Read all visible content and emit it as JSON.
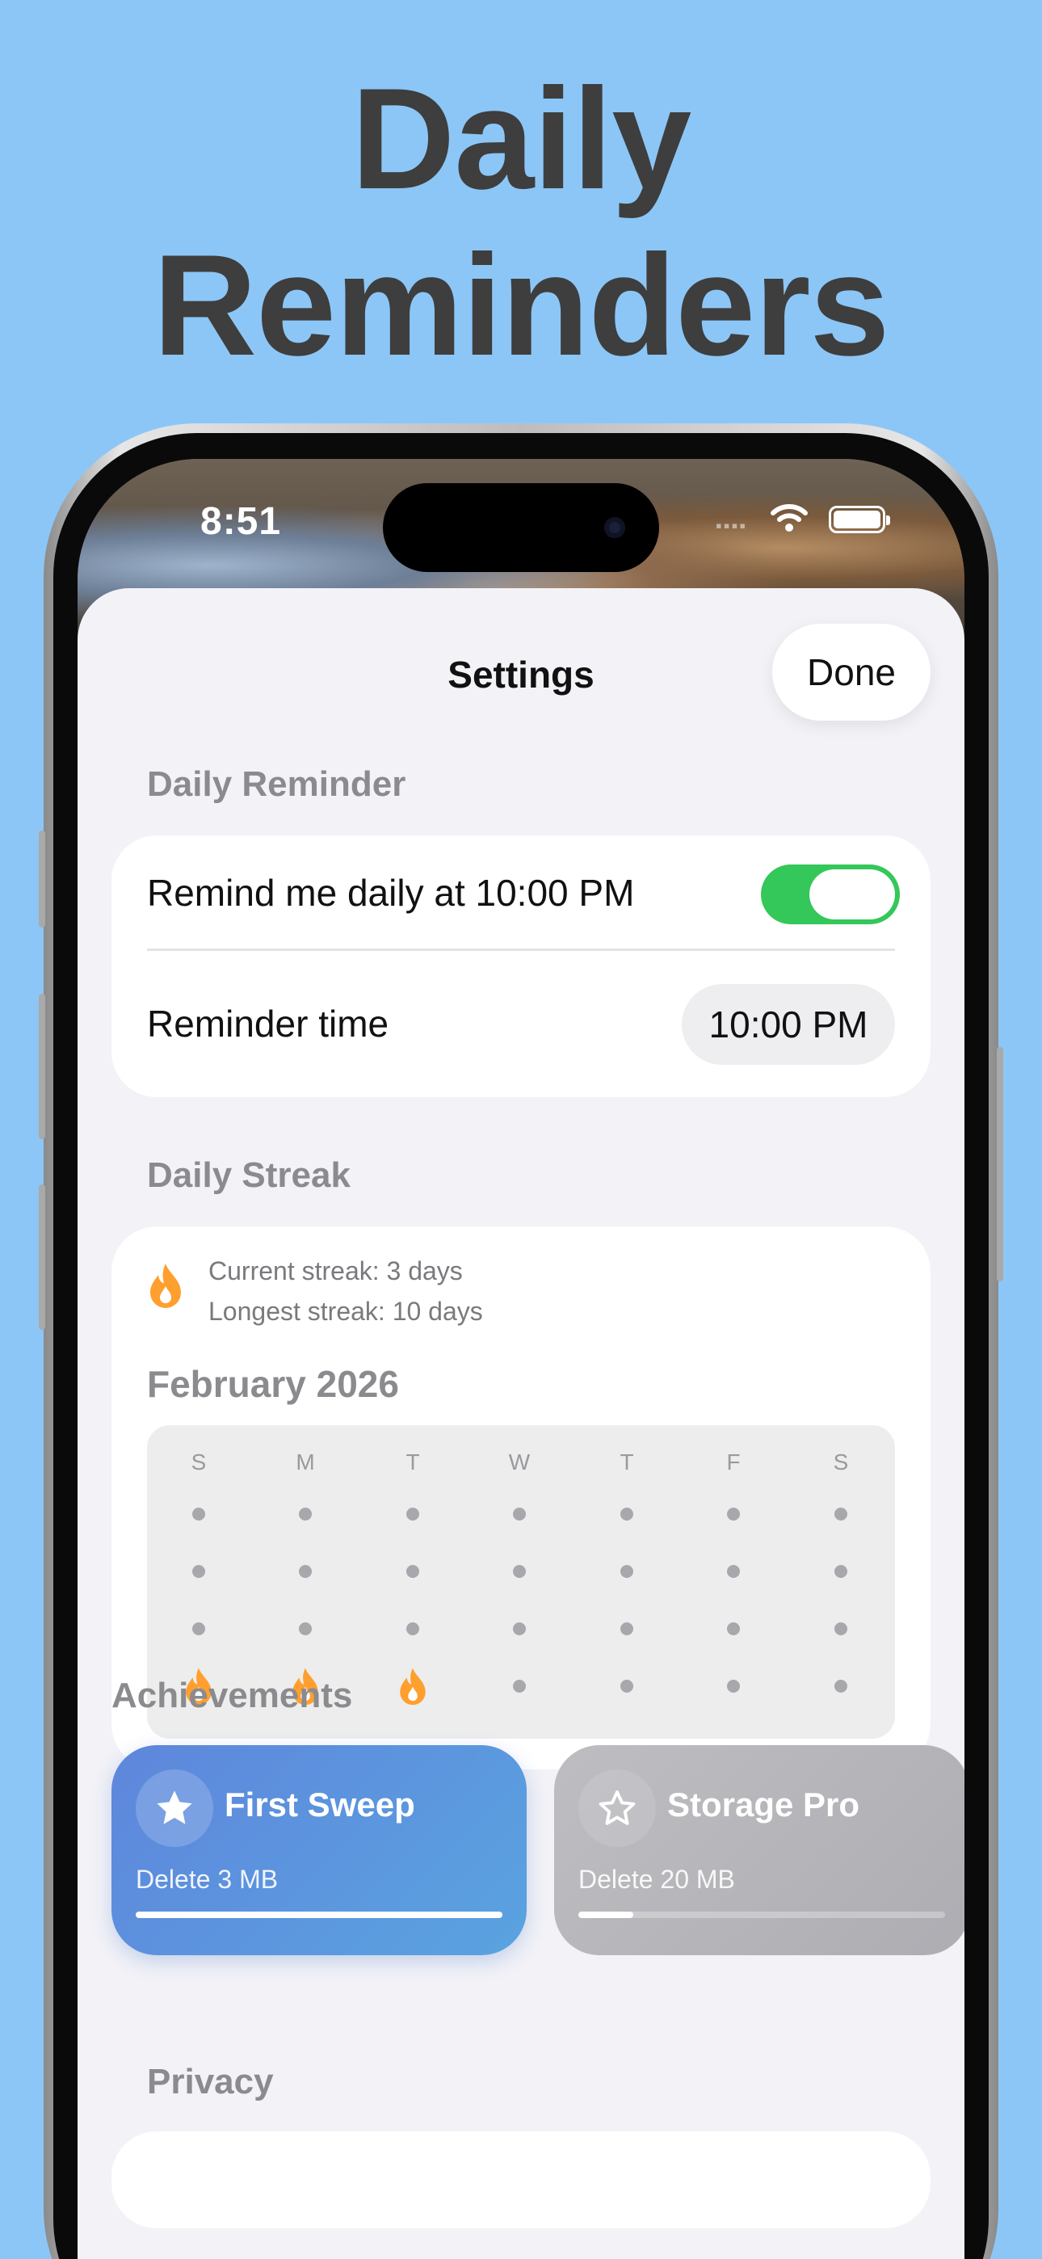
{
  "headline": {
    "line1": "Daily",
    "line2": "Reminders"
  },
  "status_bar": {
    "time": "8:51"
  },
  "sheet": {
    "title": "Settings",
    "done_label": "Done"
  },
  "daily_reminder": {
    "section_title": "Daily Reminder",
    "toggle_label": "Remind me daily at 10:00 PM",
    "toggle_on": true,
    "time_label": "Reminder time",
    "time_value": "10:00 PM"
  },
  "daily_streak": {
    "section_title": "Daily Streak",
    "current": "Current streak: 3 days",
    "longest": "Longest streak: 10 days",
    "month": "February 2026",
    "weekdays": [
      "S",
      "M",
      "T",
      "W",
      "T",
      "F",
      "S"
    ],
    "streak_days_last_row": [
      true,
      true,
      true,
      false,
      false,
      false,
      false
    ]
  },
  "achievements": {
    "section_title": "Achievements",
    "items": [
      {
        "title": "First Sweep",
        "subtitle": "Delete 3 MB",
        "progress": 1.0,
        "icon": "star-filled-icon"
      },
      {
        "title": "Storage Pro",
        "subtitle": "Delete 20 MB",
        "progress": 0.15,
        "icon": "star-outline-icon"
      }
    ]
  },
  "privacy": {
    "section_title": "Privacy"
  },
  "colors": {
    "background": "#8CC6F6",
    "toggle_on": "#34C759",
    "flame": "#FF9F2E",
    "achievement_active": "#5E86DC"
  }
}
